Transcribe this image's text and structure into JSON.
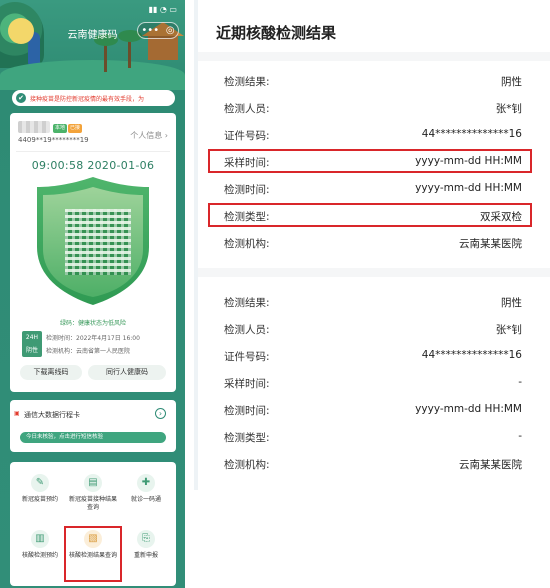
{
  "phone": {
    "status_time": "",
    "status_icons": "▮▮ ◔ ▭",
    "app_title": "云南健康码",
    "capsule_more": "•••",
    "capsule_close": "◎",
    "notice_icon": "✔",
    "notice_text": "接种疫苗是防控新冠疫情的最有效手段，为",
    "user": {
      "tag_green": "本地",
      "tag_orange": "已接",
      "id_number": "4409**19********19",
      "personal_info_link": "个人信息 ›"
    },
    "clock_text": "09:00:58  2020-01-06",
    "qr_status": "绿码：健康状态为低风险",
    "test_badge": {
      "line1": "24H",
      "line2": "阴性"
    },
    "test_time": "检测时间：2022年4月17日 16:00",
    "test_org": "检测机构：云南省第一人民医院",
    "buttons": {
      "download": "下载离线码",
      "companion": "同行人健康码"
    },
    "trip": {
      "logo": "▣",
      "title": "通信大数据行程卡",
      "arrow": "›",
      "bar_text": "今日未核验，点击进行短信核验"
    },
    "services": [
      {
        "icon": "✎",
        "label": "新冠疫苗预约"
      },
      {
        "icon": "▤",
        "label": "新冠疫苗接种结果查询"
      },
      {
        "icon": "✚",
        "label": "就诊一码通"
      },
      {
        "icon": "▥",
        "label": "核酸检测预约"
      },
      {
        "icon": "▧",
        "label": "核酸检测结果查询"
      },
      {
        "icon": "⎘",
        "label": "重新申报"
      }
    ],
    "colors": {
      "primary": "#2f8c76",
      "highlight": "#d9262a"
    }
  },
  "detail": {
    "title": "近期核酸检测结果",
    "records": [
      {
        "rows": [
          {
            "label": "检测结果:",
            "value": "阴性"
          },
          {
            "label": "检测人员:",
            "value": "张*钊"
          },
          {
            "label": "证件号码:",
            "value": "44**************16"
          },
          {
            "label": "采样时间:",
            "value": "yyyy-mm-dd HH:MM"
          },
          {
            "label": "检测时间:",
            "value": "yyyy-mm-dd HH:MM"
          },
          {
            "label": "检测类型:",
            "value": "双采双检"
          },
          {
            "label": "检测机构:",
            "value": "云南某某医院"
          }
        ]
      },
      {
        "rows": [
          {
            "label": "检测结果:",
            "value": "阴性"
          },
          {
            "label": "检测人员:",
            "value": "张*钊"
          },
          {
            "label": "证件号码:",
            "value": "44**************16"
          },
          {
            "label": "采样时间:",
            "value": "-"
          },
          {
            "label": "检测时间:",
            "value": "yyyy-mm-dd HH:MM"
          },
          {
            "label": "检测类型:",
            "value": "-"
          },
          {
            "label": "检测机构:",
            "value": "云南某某医院"
          }
        ]
      }
    ]
  }
}
